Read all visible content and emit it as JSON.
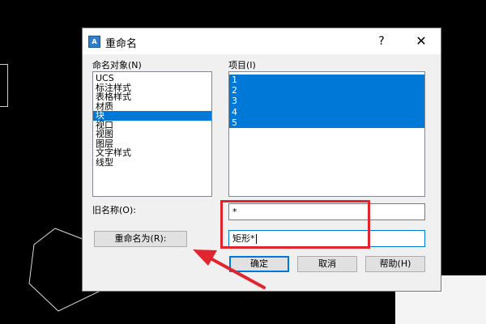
{
  "dialog": {
    "title": "重命名",
    "help_glyph": "?",
    "close_glyph": "✕",
    "app_icon_text": "A"
  },
  "objects": {
    "label": "命名对象(N)",
    "items": [
      "UCS",
      "标注样式",
      "表格样式",
      "材质",
      "块",
      "视口",
      "视图",
      "图层",
      "文字样式",
      "线型"
    ],
    "selected": "块"
  },
  "items_list": {
    "label": "项目(I)",
    "items": [
      "1",
      "2",
      "3",
      "4",
      "5"
    ]
  },
  "old_name": {
    "label": "旧名称(O):",
    "value": "*"
  },
  "rename_to": {
    "button_label": "重命名为(R):",
    "value": "矩形*"
  },
  "buttons": {
    "ok": "确定",
    "cancel": "取消",
    "help": "帮助(H)"
  },
  "colors": {
    "selection": "#0078d7",
    "annotation": "#e0252e"
  },
  "icons": [
    "app-icon",
    "help-icon",
    "close-icon",
    "annotation-arrow-icon"
  ]
}
